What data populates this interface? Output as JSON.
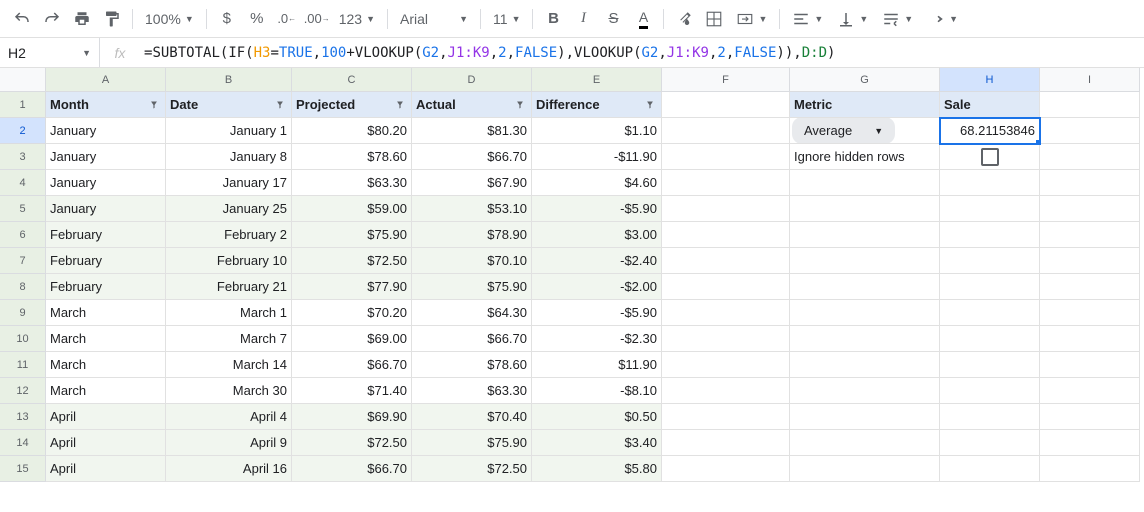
{
  "toolbar": {
    "zoom": "100%",
    "font": "Arial",
    "size": "11",
    "format123": "123"
  },
  "nameBox": "H2",
  "formula": {
    "prefix": "=",
    "tokens": [
      {
        "t": "SUBTOTAL",
        "c": "fn"
      },
      {
        "t": "(",
        "c": "fn"
      },
      {
        "t": "IF",
        "c": "fn"
      },
      {
        "t": "(",
        "c": "fn"
      },
      {
        "t": "H3",
        "c": "ref-orange"
      },
      {
        "t": "=",
        "c": "fn"
      },
      {
        "t": "TRUE",
        "c": "kw"
      },
      {
        "t": ",",
        "c": "fn"
      },
      {
        "t": "100",
        "c": "num"
      },
      {
        "t": "+",
        "c": "fn"
      },
      {
        "t": "VLOOKUP",
        "c": "fn"
      },
      {
        "t": "(",
        "c": "fn"
      },
      {
        "t": "G2",
        "c": "ref-blue"
      },
      {
        "t": ",",
        "c": "fn"
      },
      {
        "t": "J1:K9",
        "c": "ref-purple"
      },
      {
        "t": ",",
        "c": "fn"
      },
      {
        "t": "2",
        "c": "num"
      },
      {
        "t": ",",
        "c": "fn"
      },
      {
        "t": "FALSE",
        "c": "kw"
      },
      {
        "t": ")",
        "c": "fn"
      },
      {
        "t": ",",
        "c": "fn"
      },
      {
        "t": "VLOOKUP",
        "c": "fn"
      },
      {
        "t": "(",
        "c": "fn"
      },
      {
        "t": "G2",
        "c": "ref-blue"
      },
      {
        "t": ",",
        "c": "fn"
      },
      {
        "t": "J1:K9",
        "c": "ref-purple"
      },
      {
        "t": ",",
        "c": "fn"
      },
      {
        "t": "2",
        "c": "num"
      },
      {
        "t": ",",
        "c": "fn"
      },
      {
        "t": "FALSE",
        "c": "kw"
      },
      {
        "t": ")",
        "c": "fn"
      },
      {
        "t": ")",
        "c": "fn"
      },
      {
        "t": ",",
        "c": "fn"
      },
      {
        "t": "D:D",
        "c": "ref-green"
      },
      {
        "t": ")",
        "c": "fn"
      }
    ]
  },
  "columns": [
    "A",
    "B",
    "C",
    "D",
    "E",
    "F",
    "G",
    "H",
    "I"
  ],
  "headers": {
    "A": "Month",
    "B": "Date",
    "C": "Projected",
    "D": "Actual",
    "E": "Difference",
    "G": "Metric",
    "H": "Sale"
  },
  "rows": [
    {
      "n": 2,
      "A": "January",
      "B": "January 1",
      "C": "$80.20",
      "D": "$81.30",
      "E": "$1.10",
      "G_chip": "Average",
      "H": "68.21153846"
    },
    {
      "n": 3,
      "A": "January",
      "B": "January 8",
      "C": "$78.60",
      "D": "$66.70",
      "E": "-$11.90",
      "G": "Ignore hidden rows",
      "H_checkbox": true
    },
    {
      "n": 4,
      "A": "January",
      "B": "January 17",
      "C": "$63.30",
      "D": "$67.90",
      "E": "$4.60"
    },
    {
      "n": 5,
      "A": "January",
      "B": "January 25",
      "C": "$59.00",
      "D": "$53.10",
      "E": "-$5.90"
    },
    {
      "n": 6,
      "A": "February",
      "B": "February 2",
      "C": "$75.90",
      "D": "$78.90",
      "E": "$3.00"
    },
    {
      "n": 7,
      "A": "February",
      "B": "February 10",
      "C": "$72.50",
      "D": "$70.10",
      "E": "-$2.40"
    },
    {
      "n": 8,
      "A": "February",
      "B": "February 21",
      "C": "$77.90",
      "D": "$75.90",
      "E": "-$2.00"
    },
    {
      "n": 9,
      "A": "March",
      "B": "March 1",
      "C": "$70.20",
      "D": "$64.30",
      "E": "-$5.90"
    },
    {
      "n": 10,
      "A": "March",
      "B": "March 7",
      "C": "$69.00",
      "D": "$66.70",
      "E": "-$2.30"
    },
    {
      "n": 11,
      "A": "March",
      "B": "March 14",
      "C": "$66.70",
      "D": "$78.60",
      "E": "$11.90"
    },
    {
      "n": 12,
      "A": "March",
      "B": "March 30",
      "C": "$71.40",
      "D": "$63.30",
      "E": "-$8.10"
    },
    {
      "n": 13,
      "A": "April",
      "B": "April 4",
      "C": "$69.90",
      "D": "$70.40",
      "E": "$0.50"
    },
    {
      "n": 14,
      "A": "April",
      "B": "April 9",
      "C": "$72.50",
      "D": "$75.90",
      "E": "$3.40"
    },
    {
      "n": 15,
      "A": "April",
      "B": "April 16",
      "C": "$66.70",
      "D": "$72.50",
      "E": "$5.80"
    }
  ]
}
